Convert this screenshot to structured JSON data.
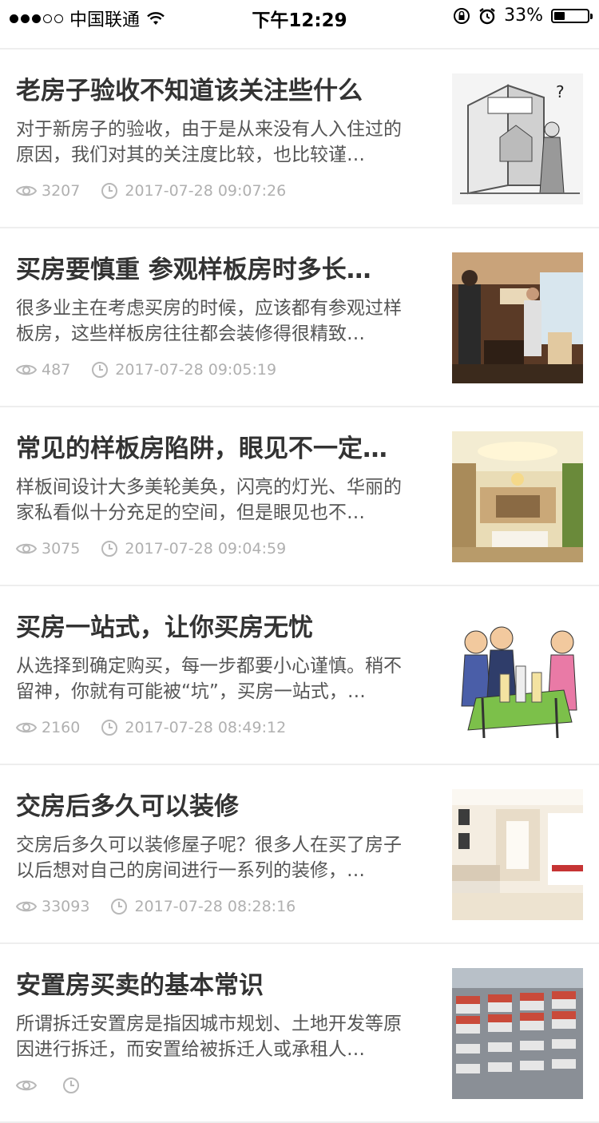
{
  "status_bar": {
    "carrier": "中国联通",
    "time": "下午12:29",
    "battery_percent": "33%",
    "battery_level": 0.33,
    "signal_bars_filled": 3,
    "signal_bars_total": 5
  },
  "articles": [
    {
      "title": "老房子验收不知道该关注些什么",
      "summary": "对于新房子的验收，由于是从来没有人入住过的原因，我们对其的关注度比较，也比较谨…",
      "views": "3207",
      "time": "2017-07-28 09:07:26",
      "thumb": "cartoon-house-inspection"
    },
    {
      "title": "买房要慎重 参观样板房时多长…",
      "summary": "很多业主在考虑买房的时候，应该都有参观过样板房，这些样板房往往都会装修得很精致…",
      "views": "487",
      "time": "2017-07-28 09:05:19",
      "thumb": "people-in-show-flat"
    },
    {
      "title": "常见的样板房陷阱，眼见不一定…",
      "summary": "样板间设计大多美轮美奂，闪亮的灯光、华丽的家私看似十分充足的空间，但是眼见也不…",
      "views": "3075",
      "time": "2017-07-28 09:04:59",
      "thumb": "luxury-living-room"
    },
    {
      "title": "买房一站式，让你买房无忧",
      "summary": "从选择到确定购买，每一步都要小心谨慎。稍不留神，你就有可能被“坑”，买房一站式，…",
      "views": "2160",
      "time": "2017-07-28 08:49:12",
      "thumb": "cartoon-buyers-model"
    },
    {
      "title": "交房后多久可以装修",
      "summary": "交房后多久可以装修屋子呢？很多人在买了房子以后想对自己的房间进行一系列的装修，…",
      "views": "33093",
      "time": "2017-07-28 08:28:16",
      "thumb": "bright-living-room"
    },
    {
      "title": "安置房买卖的基本常识",
      "summary": "所谓拆迁安置房是指因城市规划、土地开发等原因进行拆迁，而安置给被拆迁人或承租人…",
      "views": "",
      "time": "",
      "thumb": "aerial-housing-estate"
    }
  ]
}
